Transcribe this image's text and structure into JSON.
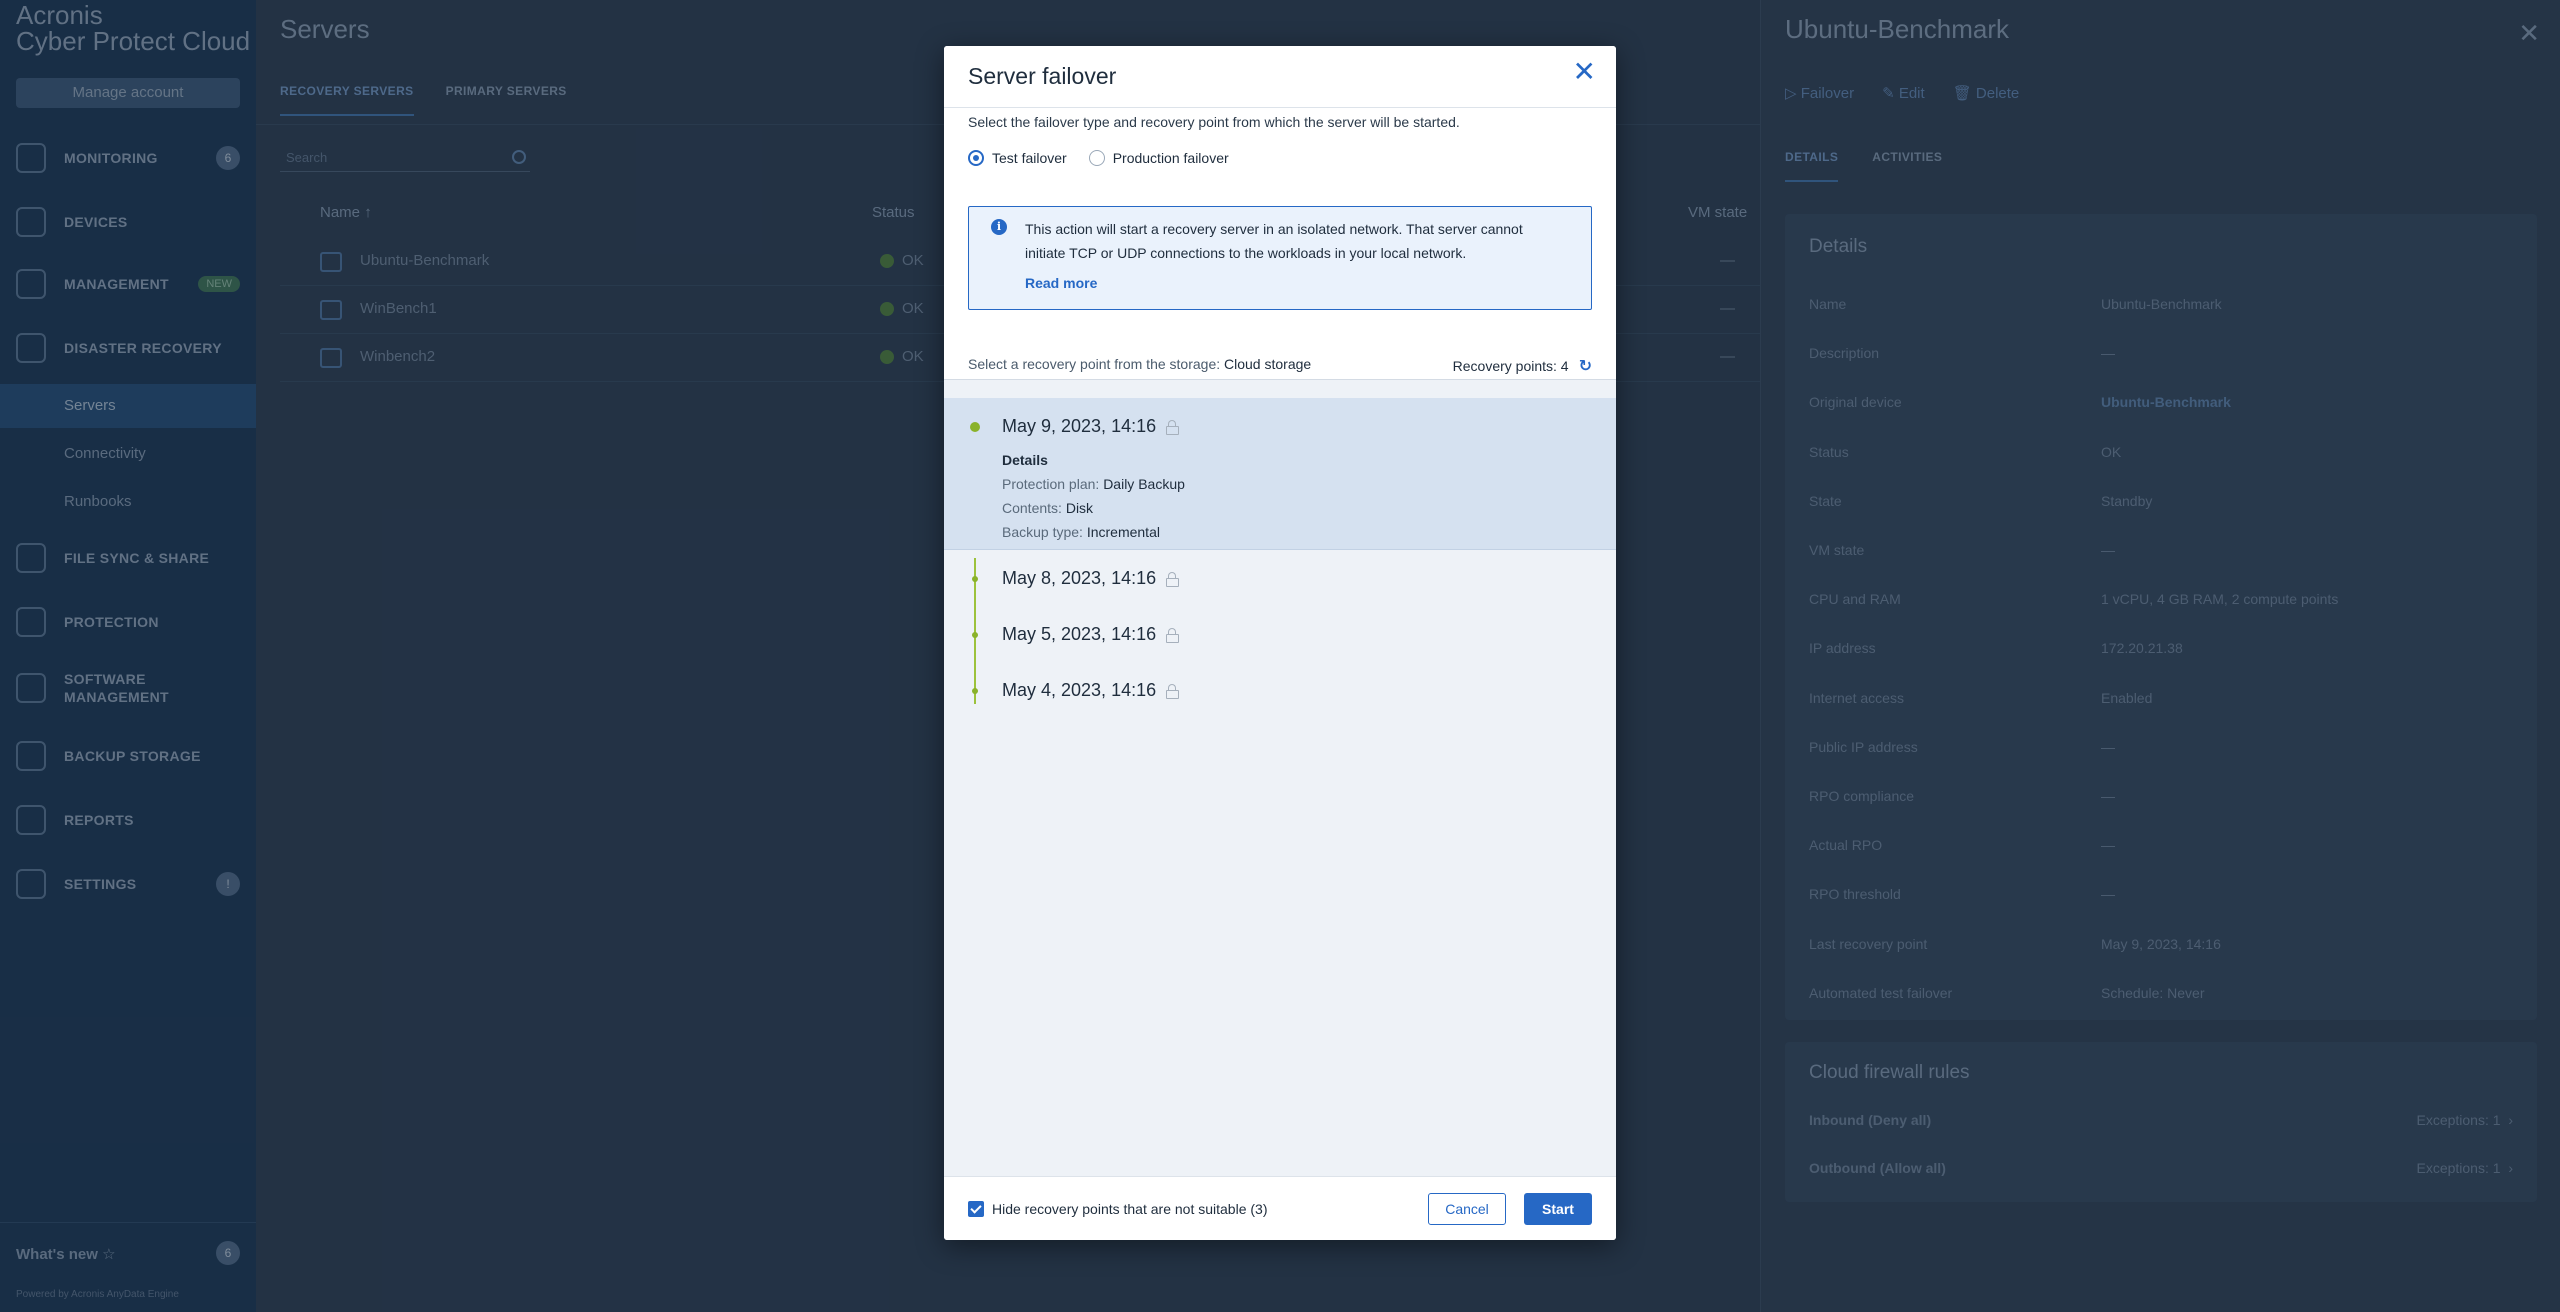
{
  "brand": {
    "line1": "Acronis",
    "line2": "Cyber Protect Cloud"
  },
  "sidebar": {
    "manage_account": "Manage account",
    "items": [
      {
        "label": "MONITORING",
        "icon": "monitoring-icon",
        "badge": "6"
      },
      {
        "label": "DEVICES",
        "icon": "devices-icon"
      },
      {
        "label": "MANAGEMENT",
        "icon": "management-icon",
        "tag": "NEW"
      },
      {
        "label": "DISASTER RECOVERY",
        "icon": "disaster-recovery-icon"
      },
      {
        "label": "FILE SYNC & SHARE",
        "icon": "file-sync-icon"
      },
      {
        "label": "PROTECTION",
        "icon": "protection-icon"
      },
      {
        "label": "SOFTWARE MANAGEMENT",
        "icon": "software-management-icon"
      },
      {
        "label": "BACKUP STORAGE",
        "icon": "backup-storage-icon"
      },
      {
        "label": "REPORTS",
        "icon": "reports-icon"
      },
      {
        "label": "SETTINGS",
        "icon": "settings-icon",
        "badge": "!"
      }
    ],
    "sub_items": [
      "Servers",
      "Connectivity",
      "Runbooks"
    ],
    "whats_new": "What's new",
    "whats_new_badge": "6",
    "powered_by": "Powered by Acronis AnyData Engine"
  },
  "main": {
    "title": "Servers",
    "tabs": [
      "RECOVERY SERVERS",
      "PRIMARY SERVERS"
    ],
    "search_placeholder": "Search",
    "columns": {
      "name": "Name",
      "status": "Status",
      "vm_state": "VM state"
    },
    "rows": [
      {
        "name": "Ubuntu-Benchmark",
        "status": "OK",
        "vm_state": "—"
      },
      {
        "name": "WinBench1",
        "status": "OK",
        "vm_state": "—"
      },
      {
        "name": "Winbench2",
        "status": "OK",
        "vm_state": "—"
      }
    ]
  },
  "details": {
    "title": "Ubuntu-Benchmark",
    "actions": [
      "Failover",
      "Edit",
      "Delete"
    ],
    "tabs": [
      "DETAILS",
      "ACTIVITIES"
    ],
    "card_title": "Details",
    "fields": [
      {
        "label": "Name",
        "value": "Ubuntu-Benchmark"
      },
      {
        "label": "Description",
        "value": "—"
      },
      {
        "label": "Original device",
        "value": "Ubuntu-Benchmark"
      },
      {
        "label": "Status",
        "value": "OK"
      },
      {
        "label": "State",
        "value": "Standby"
      },
      {
        "label": "VM state",
        "value": "—"
      },
      {
        "label": "CPU and RAM",
        "value": "1 vCPU, 4 GB RAM, 2 compute points"
      },
      {
        "label": "IP address",
        "value": "172.20.21.38"
      },
      {
        "label": "Internet access",
        "value": "Enabled"
      },
      {
        "label": "Public IP address",
        "value": "—"
      },
      {
        "label": "RPO compliance",
        "value": "—"
      },
      {
        "label": "Actual RPO",
        "value": "—"
      },
      {
        "label": "RPO threshold",
        "value": "—"
      },
      {
        "label": "Last recovery point",
        "value": "May 9, 2023, 14:16"
      },
      {
        "label": "Automated test failover",
        "value": "Schedule: Never"
      }
    ],
    "firewall_title": "Cloud firewall rules",
    "firewall": [
      {
        "label": "Inbound (Deny all)",
        "value": "Exceptions: 1"
      },
      {
        "label": "Outbound (Allow all)",
        "value": "Exceptions: 1"
      }
    ]
  },
  "modal": {
    "title": "Server failover",
    "intro": "Select the failover type and recovery point from which the server will be started.",
    "radio_test": "Test failover",
    "radio_production": "Production failover",
    "info_text": "This action will start a recovery server in an isolated network. That server cannot initiate TCP or UDP connections to the workloads in your local network.",
    "read_more": "Read more",
    "storage_label": "Select a recovery point from the storage:",
    "storage_value": "Cloud storage",
    "recovery_points_label": "Recovery points: 4",
    "recovery_points": [
      {
        "date": "May 9, 2023, 14:16"
      },
      {
        "date": "May 8, 2023, 14:16"
      },
      {
        "date": "May 5, 2023, 14:16"
      },
      {
        "date": "May 4, 2023, 14:16"
      }
    ],
    "selected_details": {
      "title": "Details",
      "plan_label": "Protection plan:",
      "plan_value": "Daily Backup",
      "contents_label": "Contents:",
      "contents_value": "Disk",
      "type_label": "Backup type:",
      "type_value": "Incremental"
    },
    "hide_checkbox": "Hide recovery points that are not suitable (3)",
    "cancel": "Cancel",
    "start": "Start"
  }
}
